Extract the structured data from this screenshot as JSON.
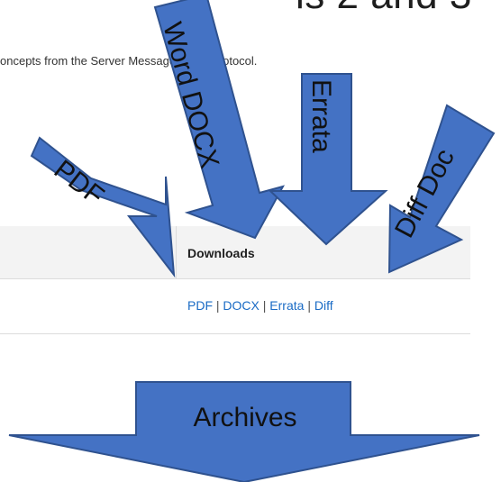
{
  "page": {
    "heading": "ls 2 and 3",
    "intro_text": "oncepts from the Server Message Block Protocol."
  },
  "table": {
    "downloads_header": "Downloads",
    "links": {
      "pdf": "PDF",
      "docx": "DOCX",
      "errata": "Errata",
      "diff": "Diff",
      "separator": "|"
    }
  },
  "callouts": {
    "pdf": "PDF",
    "word_docx": "Word DOCX",
    "errata": "Errata",
    "diff_doc": "Diff Doc",
    "archives": "Archives"
  },
  "colors": {
    "arrow_fill": "#4472c4",
    "arrow_stroke": "#2f528f",
    "link": "#1a6bc5",
    "header_bg": "#f3f3f3"
  }
}
